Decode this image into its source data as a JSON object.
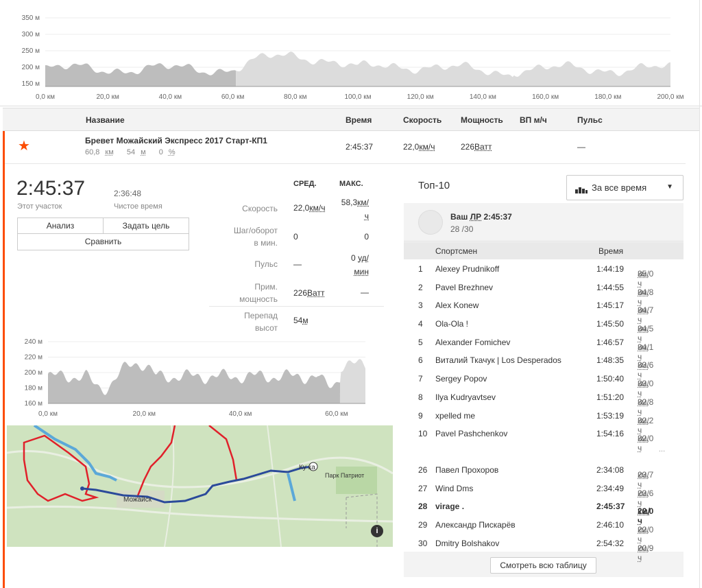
{
  "top_chart": {
    "y_ticks": [
      "350 м",
      "300 м",
      "250 м",
      "200 м",
      "150 м"
    ],
    "x_ticks": [
      "0,0 км",
      "20,0 км",
      "40,0 км",
      "60,0 км",
      "80,0 км",
      "100,0 км",
      "120,0 км",
      "140,0 км",
      "160,0 км",
      "180,0 км",
      "200,0 км"
    ]
  },
  "segment_table": {
    "headers": {
      "name": "Название",
      "time": "Время",
      "speed": "Скорость",
      "power": "Мощность",
      "vam": "ВП м/ч",
      "hr": "Пульс"
    },
    "row": {
      "name": "Бревет Можайский Экспресс 2017 Старт-КП1",
      "distance": "60,8",
      "distance_unit": "км",
      "elevation": "54",
      "elevation_unit": "м",
      "grade": "0",
      "grade_unit": "%",
      "time": "2:45:37",
      "speed": "22,0",
      "speed_unit": "км/ч",
      "power": "226",
      "power_unit": "Ватт",
      "hr": "—"
    }
  },
  "detail": {
    "elapsed": "2:45:37",
    "elapsed_label": "Этот участок",
    "moving": "2:36:48",
    "moving_label": "Чистое время",
    "buttons": {
      "analysis": "Анализ",
      "goal": "Задать цель",
      "compare": "Сравнить"
    },
    "stats": {
      "head_avg": "СРЕД.",
      "head_max": "МАКС.",
      "speed_label": "Скорость",
      "speed_avg": "22,0",
      "speed_avg_unit": "км/ч",
      "speed_max": "58,3",
      "speed_max_unit_1": "км/",
      "speed_max_unit_2": "ч",
      "cadence_label_1": "Шаг/оборот",
      "cadence_label_2": "в мин.",
      "cadence_avg": "0",
      "cadence_max": "0",
      "hr_label": "Пульс",
      "hr_avg": "—",
      "hr_max": "0",
      "hr_unit_1": "уд/",
      "hr_unit_2": "мин",
      "power_label_1": "Прим.",
      "power_label_2": "мощность",
      "power_avg": "226",
      "power_avg_unit": "Ватт",
      "power_max": "—",
      "elev_label_1": "Перепад",
      "elev_label_2": "высот",
      "elev_val": "54",
      "elev_unit": "м"
    }
  },
  "mid_chart": {
    "y_ticks": [
      "240 м",
      "220 м",
      "200 м",
      "180 м",
      "160 м"
    ],
    "x_ticks": [
      "0,0 км",
      "20,0 км",
      "40,0 км",
      "60,0 км"
    ]
  },
  "map": {
    "labels": {
      "town": "Можайск",
      "park": "Парк Патриот",
      "kubinka": "Ку    ка"
    },
    "info_icon": "i",
    "colors": {
      "route": "#2b4a9a",
      "other_route": "#e0202a",
      "water": "#5ba8d8"
    }
  },
  "top10": {
    "title": "Топ-10",
    "filter_label": "За все время",
    "my_pr_label": "Ваш ",
    "my_pr_abbr": "ЛР",
    "my_pr_time": " 2:45:37",
    "my_rank": "28 /30",
    "col_athlete": "Спортсмен",
    "col_time": "Время",
    "ellipsis": "...",
    "rows_top": [
      {
        "rank": "1",
        "name": "Alexey Prudnikoff",
        "time": "1:44:19",
        "speed": "35,0",
        "unit": "км/ч"
      },
      {
        "rank": "2",
        "name": "Pavel Brezhnev",
        "time": "1:44:55",
        "speed": "34,8",
        "unit": "км/ч"
      },
      {
        "rank": "3",
        "name": "Alex Konew",
        "time": "1:45:17",
        "speed": "34,7",
        "unit": "км/ч"
      },
      {
        "rank": "4",
        "name": "Ola-Ola !",
        "time": "1:45:50",
        "speed": "34,5",
        "unit": "км/ч"
      },
      {
        "rank": "5",
        "name": "Alexander Fomichev",
        "time": "1:46:57",
        "speed": "34,1",
        "unit": "км/ч"
      },
      {
        "rank": "6",
        "name": "Виталий Ткачук | Los Desperados",
        "time": "1:48:35",
        "speed": "33,6",
        "unit": "км/ч"
      },
      {
        "rank": "7",
        "name": "Sergey Popov",
        "time": "1:50:40",
        "speed": "33,0",
        "unit": "км/ч"
      },
      {
        "rank": "8",
        "name": "Ilya Kudryavtsev",
        "time": "1:51:20",
        "speed": "32,8",
        "unit": "км/ч"
      },
      {
        "rank": "9",
        "name": "xpelled me",
        "time": "1:53:19",
        "speed": "32,2",
        "unit": "км/ч"
      },
      {
        "rank": "10",
        "name": "Pavel Pashchenkov",
        "time": "1:54:16",
        "speed": "32,0",
        "unit": "км/ч"
      }
    ],
    "rows_near": [
      {
        "rank": "26",
        "name": "Павел Прохоров",
        "time": "2:34:08",
        "speed": "23,7",
        "unit": "км/ч"
      },
      {
        "rank": "27",
        "name": "Wind Dms",
        "time": "2:34:49",
        "speed": "23,6",
        "unit": "км/ч"
      },
      {
        "rank": "28",
        "name": "virage .",
        "time": "2:45:37",
        "speed": "22,0",
        "unit": "км/ч",
        "me": true
      },
      {
        "rank": "29",
        "name": "Александр Пискарёв",
        "time": "2:46:10",
        "speed": "22,0",
        "unit": "км/ч"
      },
      {
        "rank": "30",
        "name": "Dmitry Bolshakov",
        "time": "2:54:32",
        "speed": "20,9",
        "unit": "км/ч"
      }
    ],
    "see_all": "Смотреть всю таблицу"
  },
  "colors": {
    "accent": "#fc4c02"
  }
}
